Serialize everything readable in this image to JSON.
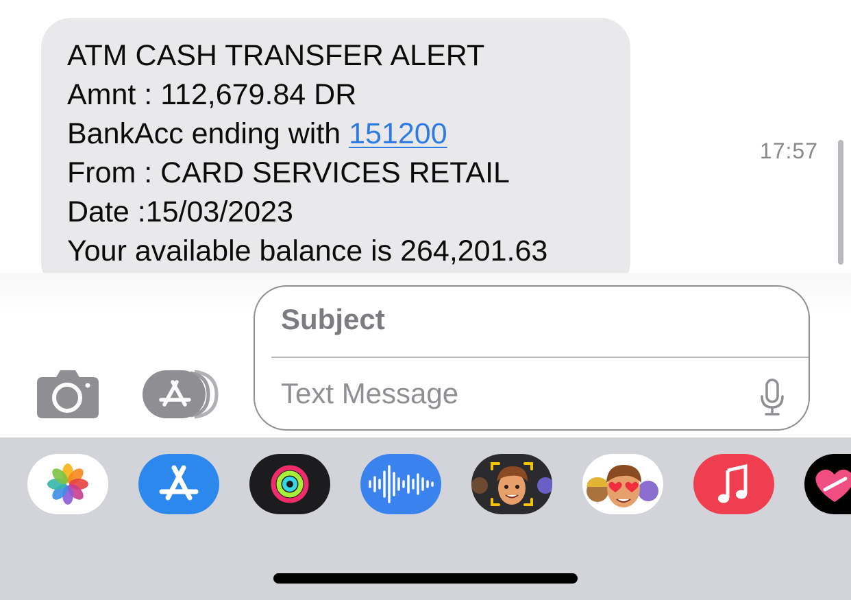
{
  "message": {
    "lines": [
      "ATM CASH TRANSFER ALERT",
      "Amnt : 112,679.84 DR",
      "BankAcc ending with ",
      "From : CARD SERVICES RETAIL",
      "Date :15/03/2023",
      "Your available balance is 264,201.63"
    ],
    "account_link": "151200",
    "timestamp": "17:57"
  },
  "compose": {
    "subject_placeholder": "Subject",
    "text_placeholder": "Text Message"
  },
  "app_drawer": {
    "apps": [
      {
        "name": "photos-app-icon"
      },
      {
        "name": "app-store-app-icon"
      },
      {
        "name": "activity-app-icon"
      },
      {
        "name": "audio-message-app-icon"
      },
      {
        "name": "memoji-camera-app-icon"
      },
      {
        "name": "memoji-stickers-app-icon"
      },
      {
        "name": "music-app-icon"
      },
      {
        "name": "digital-touch-app-icon"
      }
    ]
  },
  "colors": {
    "bubble": "#e9e9eb",
    "link": "#2f7be6",
    "drawer": "#d2d4d9"
  }
}
